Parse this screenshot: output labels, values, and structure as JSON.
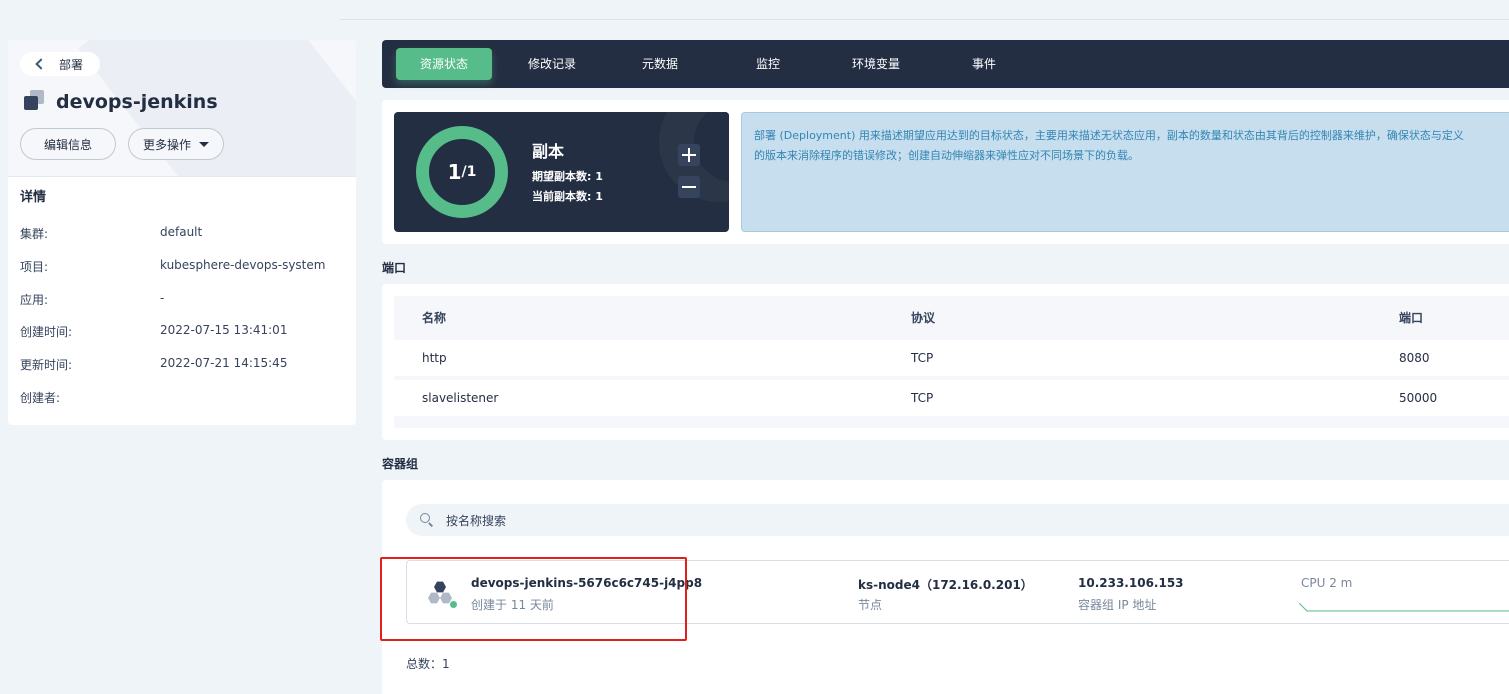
{
  "left": {
    "back_label": "部署",
    "title": "devops-jenkins",
    "edit_label": "编辑信息",
    "more_label": "更多操作",
    "details_title": "详情",
    "details": [
      {
        "key": "集群:",
        "value": "default"
      },
      {
        "key": "项目:",
        "value": "kubesphere-devops-system"
      },
      {
        "key": "应用:",
        "value": "-"
      },
      {
        "key": "创建时间:",
        "value": "2022-07-15 13:41:01"
      },
      {
        "key": "更新时间:",
        "value": "2022-07-21 14:15:45"
      },
      {
        "key": "创建者:",
        "value": ""
      }
    ]
  },
  "tabs": [
    "资源状态",
    "修改记录",
    "元数据",
    "监控",
    "环境变量",
    "事件"
  ],
  "replica": {
    "current": "1",
    "total": "/1",
    "title": "副本",
    "desired_label": "期望副本数: 1",
    "current_label": "当前副本数: 1"
  },
  "info": {
    "line1": "部署 (Deployment) 用来描述期望应用达到的目标状态，主要用来描述无状态应用，副本的数量和状态由其背后的控制器来维护，确保状态与定义",
    "line2": "的版本来消除程序的错误修改；创建自动伸缩器来弹性应对不同场景下的负载。"
  },
  "ports": {
    "title": "端口",
    "headers": [
      "名称",
      "协议",
      "端口"
    ],
    "rows": [
      [
        "http",
        "TCP",
        "8080"
      ],
      [
        "slavelistener",
        "TCP",
        "50000"
      ]
    ]
  },
  "pods": {
    "title": "容器组",
    "search_placeholder": "按名称搜索",
    "items": [
      {
        "name": "devops-jenkins-5676c6c745-j4pp8",
        "created": "创建于 11 天前",
        "node": "ks-node4（172.16.0.201）",
        "node_label": "节点",
        "ip": "10.233.106.153",
        "ip_label": "容器组 IP 地址",
        "cpu": "CPU 2 m"
      }
    ],
    "total_label": "总数：1"
  },
  "colors": {
    "accent": "#55bc8a",
    "dark": "#242e42",
    "info_bg": "#c7deef",
    "highlight": "#e0201b"
  }
}
